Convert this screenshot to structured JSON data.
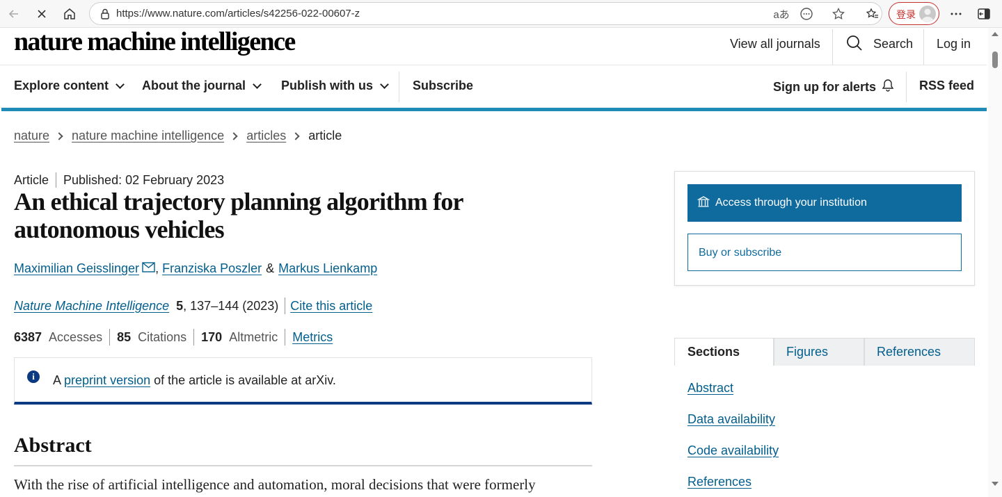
{
  "browser": {
    "url": "https://www.nature.com/articles/s42256-022-00607-z",
    "login_label": "登录"
  },
  "site": {
    "logo": "nature machine intelligence",
    "top_nav": {
      "view_all": "View all journals",
      "search": "Search",
      "login": "Log in"
    },
    "main_nav": {
      "explore": "Explore content",
      "about": "About the journal",
      "publish": "Publish with us",
      "subscribe": "Subscribe",
      "alerts": "Sign up for alerts",
      "rss": "RSS feed"
    },
    "accent_color": "#1f8cb8"
  },
  "breadcrumb": {
    "items": [
      "nature",
      "nature machine intelligence",
      "articles"
    ],
    "current": "article"
  },
  "article": {
    "type": "Article",
    "published": "Published: 02 February 2023",
    "title": "An ethical trajectory planning algorithm for autonomous vehicles",
    "authors": {
      "a1": "Maximilian Geisslinger",
      "a2": "Franziska Poszler",
      "amp": "&",
      "a3": "Markus Lienkamp"
    },
    "journal": {
      "name": "Nature Machine Intelligence",
      "volume": "5",
      "pages": ", 137–144 (2023)",
      "cite": "Cite this article"
    },
    "metrics": {
      "accesses_value": "6387",
      "accesses_label": "Accesses",
      "citations_value": "85",
      "citations_label": "Citations",
      "altmetric_value": "170",
      "altmetric_label": "Altmetric",
      "metrics_link": "Metrics"
    },
    "notice": {
      "prefix": "A",
      "link": "preprint version",
      "suffix": "of the article is available at arXiv."
    },
    "abstract_heading": "Abstract",
    "abstract_first_line": "With the rise of artificial intelligence and automation, moral decisions that were formerly"
  },
  "sidebar": {
    "access_button": "Access through your institution",
    "buy_button": "Buy or subscribe",
    "tabs": [
      "Sections",
      "Figures",
      "References"
    ],
    "section_links": [
      "Abstract",
      "Data availability",
      "Code availability",
      "References"
    ]
  }
}
